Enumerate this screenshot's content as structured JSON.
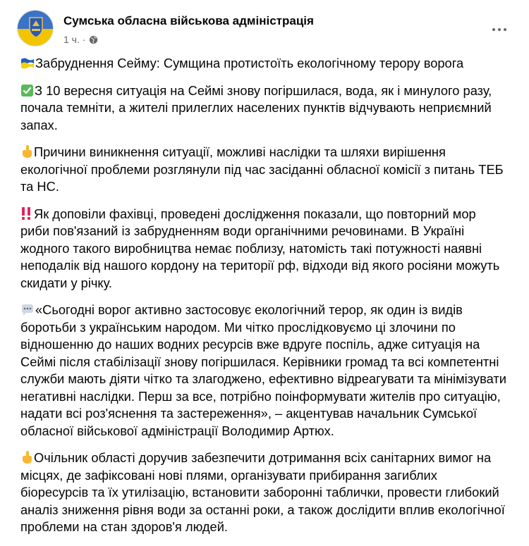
{
  "header": {
    "author": "Сумська обласна військова адміністрація",
    "time": "1 ч.",
    "separator": "·",
    "privacy_icon": "globe-icon",
    "more_icon": "more-dots-icon"
  },
  "post": {
    "title": "Забруднення Сейму: Сумщина протистоїть екологічному терору ворога",
    "paragraphs": [
      {
        "emoji": "check-mark-icon",
        "text": "З 10 вересня ситуація на Сеймі знову погіршилася, вода, як і минулого разу, почала темніти, а жителі прилеглих населених пунктів відчувають неприємний запах."
      },
      {
        "emoji": "pointing-up-icon",
        "text": "Причини виникнення ситуації, можливі наслідки та шляхи вирішення екологічної проблеми розглянули під час засіданні обласної комісії з питань ТЕБ та НС."
      },
      {
        "emoji": "double-exclamation-icon",
        "text": "Як доповіли фахівці, проведені дослідження показали, що повторний мор риби пов'язаний із забрудненням води органічними речовинами. В Україні жодного такого виробництва немає поблизу, натомість такі потужності наявні неподалік від нашого кордону на території рф, відходи від якого росіяни можуть скидати у річку."
      },
      {
        "emoji": "speech-bubble-icon",
        "text": "«Сьогодні ворог активно застосовує екологічний терор, як один із видів боротьби з українським народом. Ми чітко прослідковуємо ці злочини по відношенню до наших водних ресурсів вже вдруге поспіль, адже ситуація на Сеймі після стабілізації знову погіршилася. Керівники громад та всі компетентні служби мають діяти чітко та злагоджено, ефективно відреагувати та мінімізувати негативні наслідки. Перш за все, потрібно поінформувати жителів про ситуацію, надати всі роз'яснення та застереження», – акцентував начальник Сумської обласної військової адміністрації Володимир Артюх."
      },
      {
        "emoji": "pointing-up-icon",
        "text": "Очільник області доручив забезпечити дотримання всіх санітарних вимог на місцях, де зафіксовані нові плями, організувати прибирання загиблих біоресурсів та їх утилізацію, встановити заборонні таблички, провести глибокий аналіз зниження рівня води за останні роки, а також дослідити вплив екологічної проблеми на стан здоров'я людей."
      }
    ]
  },
  "colors": {
    "text": "#050505",
    "secondary": "#65676b",
    "flag_blue": "#1f5fbf",
    "flag_yellow": "#f5d000",
    "check_green": "#5ab95b",
    "exclaim_red": "#e0245e"
  }
}
